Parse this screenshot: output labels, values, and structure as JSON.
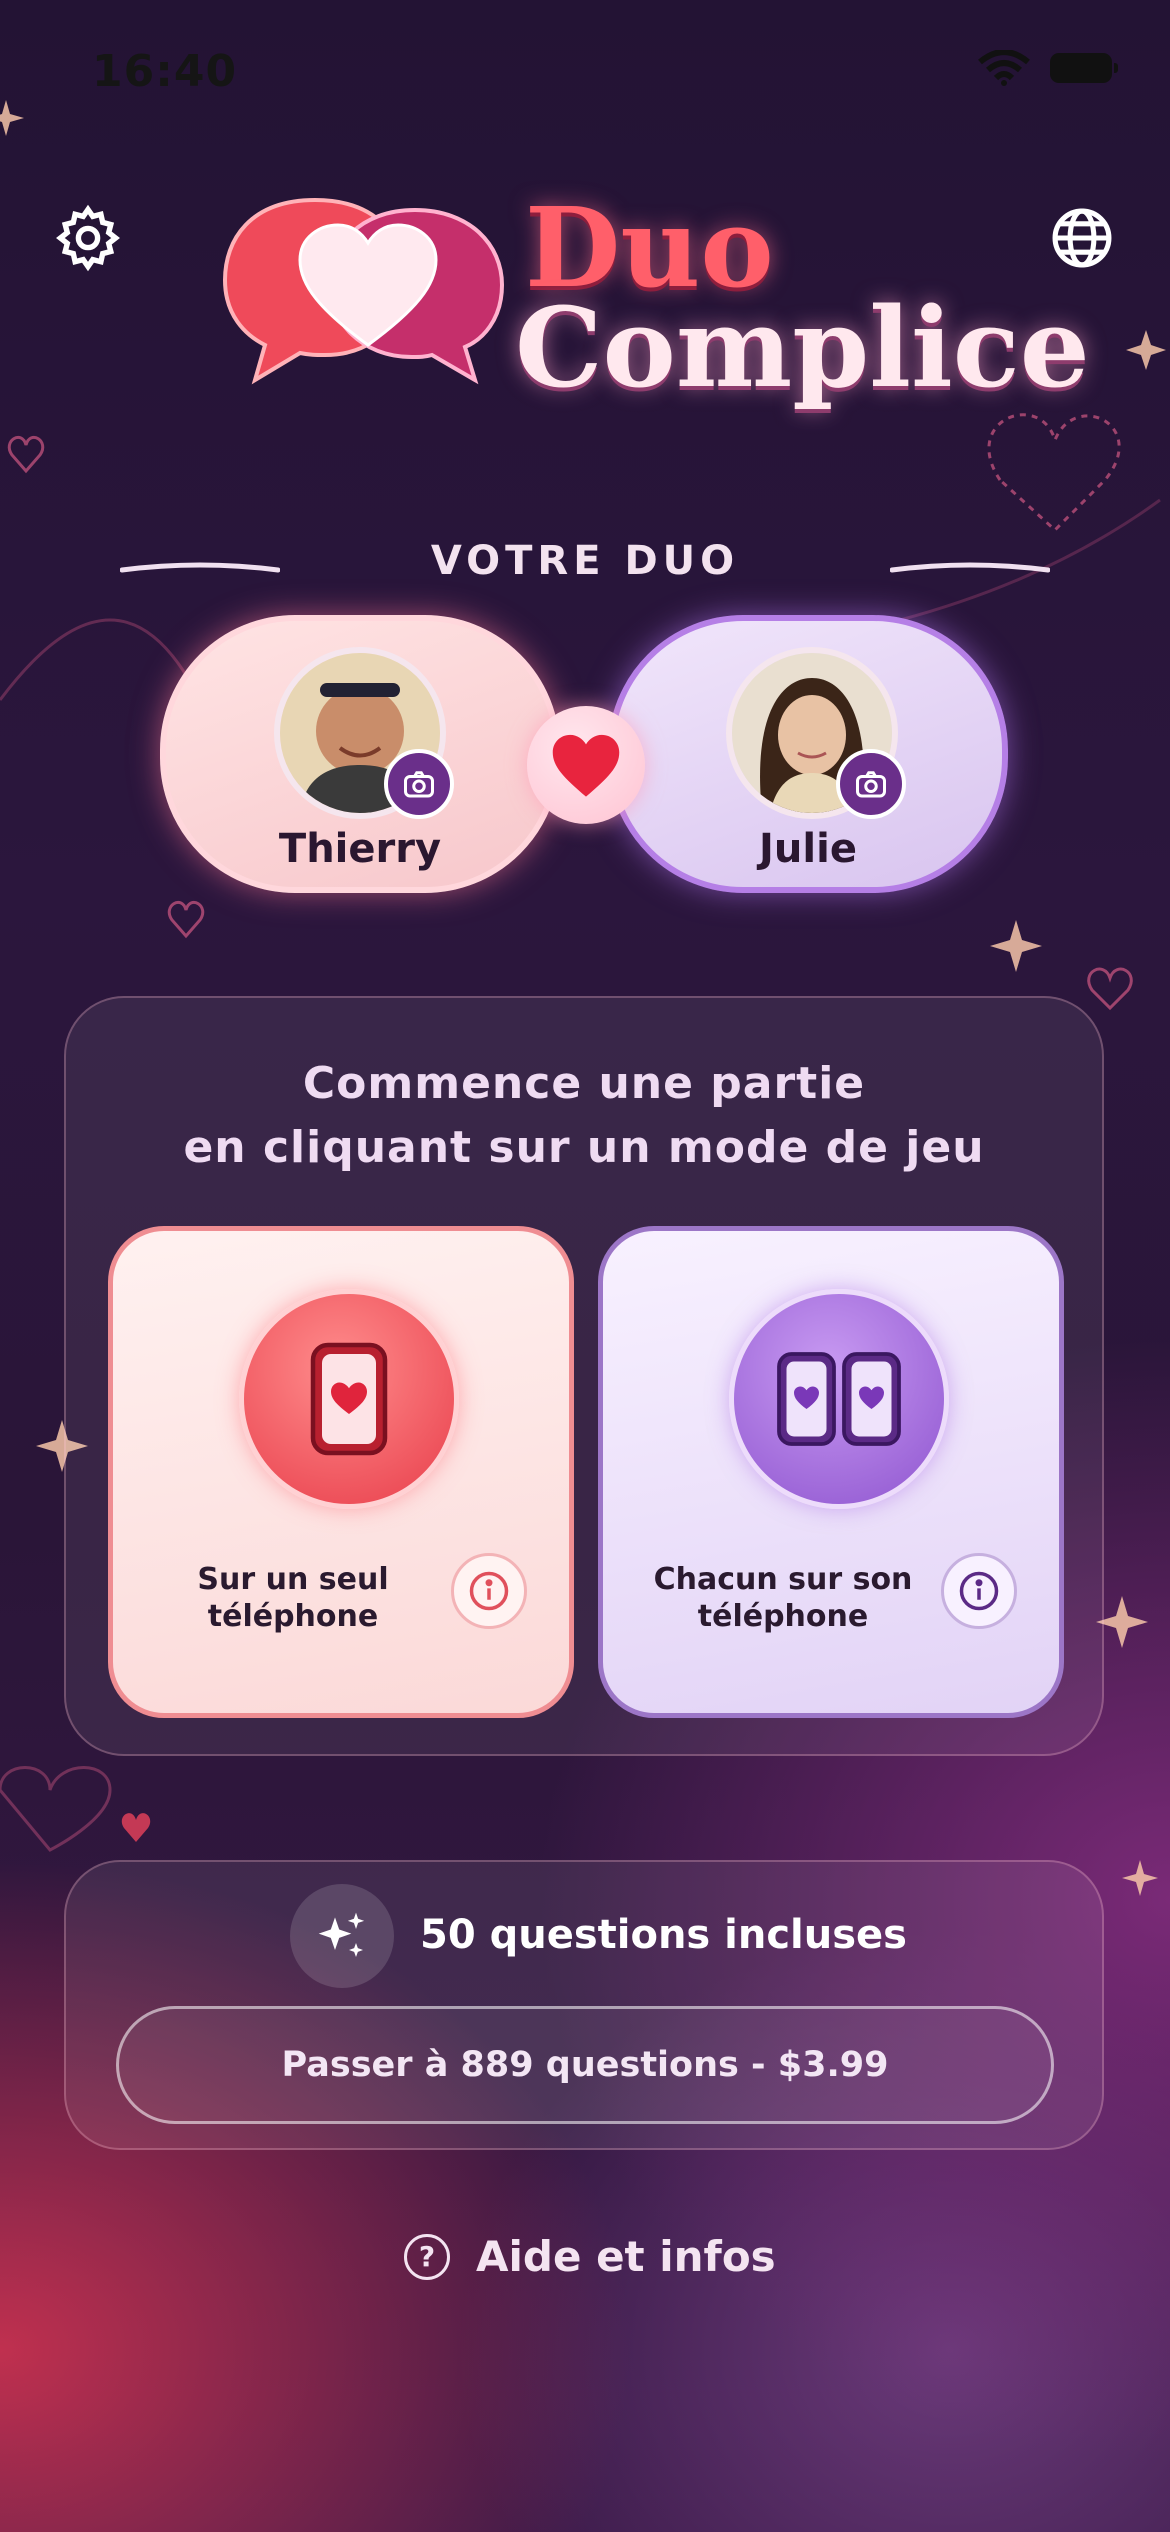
{
  "status_bar": {
    "time": "16:40"
  },
  "header": {
    "settings_icon": "gear-icon",
    "language_icon": "globe-icon",
    "logo_line1": "Duo",
    "logo_line2": "Complice"
  },
  "duo": {
    "section_title": "VOTRE DUO",
    "player1": {
      "name": "Thierry"
    },
    "player2": {
      "name": "Julie"
    }
  },
  "modes": {
    "title_line1": "Commence une partie",
    "title_line2": "en cliquant sur un mode de jeu",
    "single": {
      "label_line1": "Sur un seul",
      "label_line2": "téléphone"
    },
    "each": {
      "label_line1": "Chacun sur son",
      "label_line2": "téléphone"
    }
  },
  "questions": {
    "included": "50 questions incluses",
    "upgrade_label": "Passer à 889 questions - $3.99"
  },
  "help": {
    "label": "Aide et infos",
    "icon_text": "?"
  },
  "colors": {
    "accent_pink": "#ef6b78",
    "accent_purple": "#9c6fd6",
    "background": "#2a1538"
  }
}
